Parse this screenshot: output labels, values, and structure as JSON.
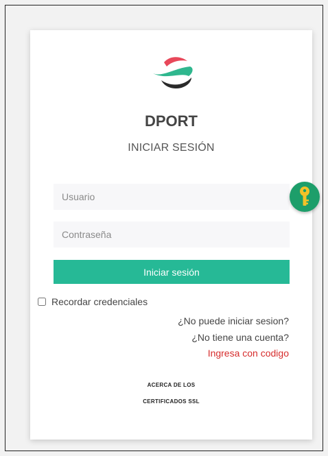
{
  "brand": {
    "name": "DPORT",
    "subtitle": "INICIAR SESIÓN"
  },
  "form": {
    "username_placeholder": "Usuario",
    "password_placeholder": "Contraseña",
    "login_button": "Iniciar sesión",
    "remember_label": "Recordar credenciales",
    "remember_checked": false
  },
  "links": {
    "cant_login": "¿No puede iniciar sesion?",
    "no_account": "¿No tiene una cuenta?",
    "login_with_code": "Ingresa con codigo"
  },
  "ssl_info": {
    "line1": "ACERCA DE LOS",
    "line2": "CERTIFICADOS SSL"
  },
  "icons": {
    "logo": "dport-logo",
    "key_badge": "key-icon"
  },
  "colors": {
    "primary": "#26b996",
    "link_accent": "#d62c2c",
    "key_badge": "#1d9e6a",
    "key": "#f3c228"
  }
}
